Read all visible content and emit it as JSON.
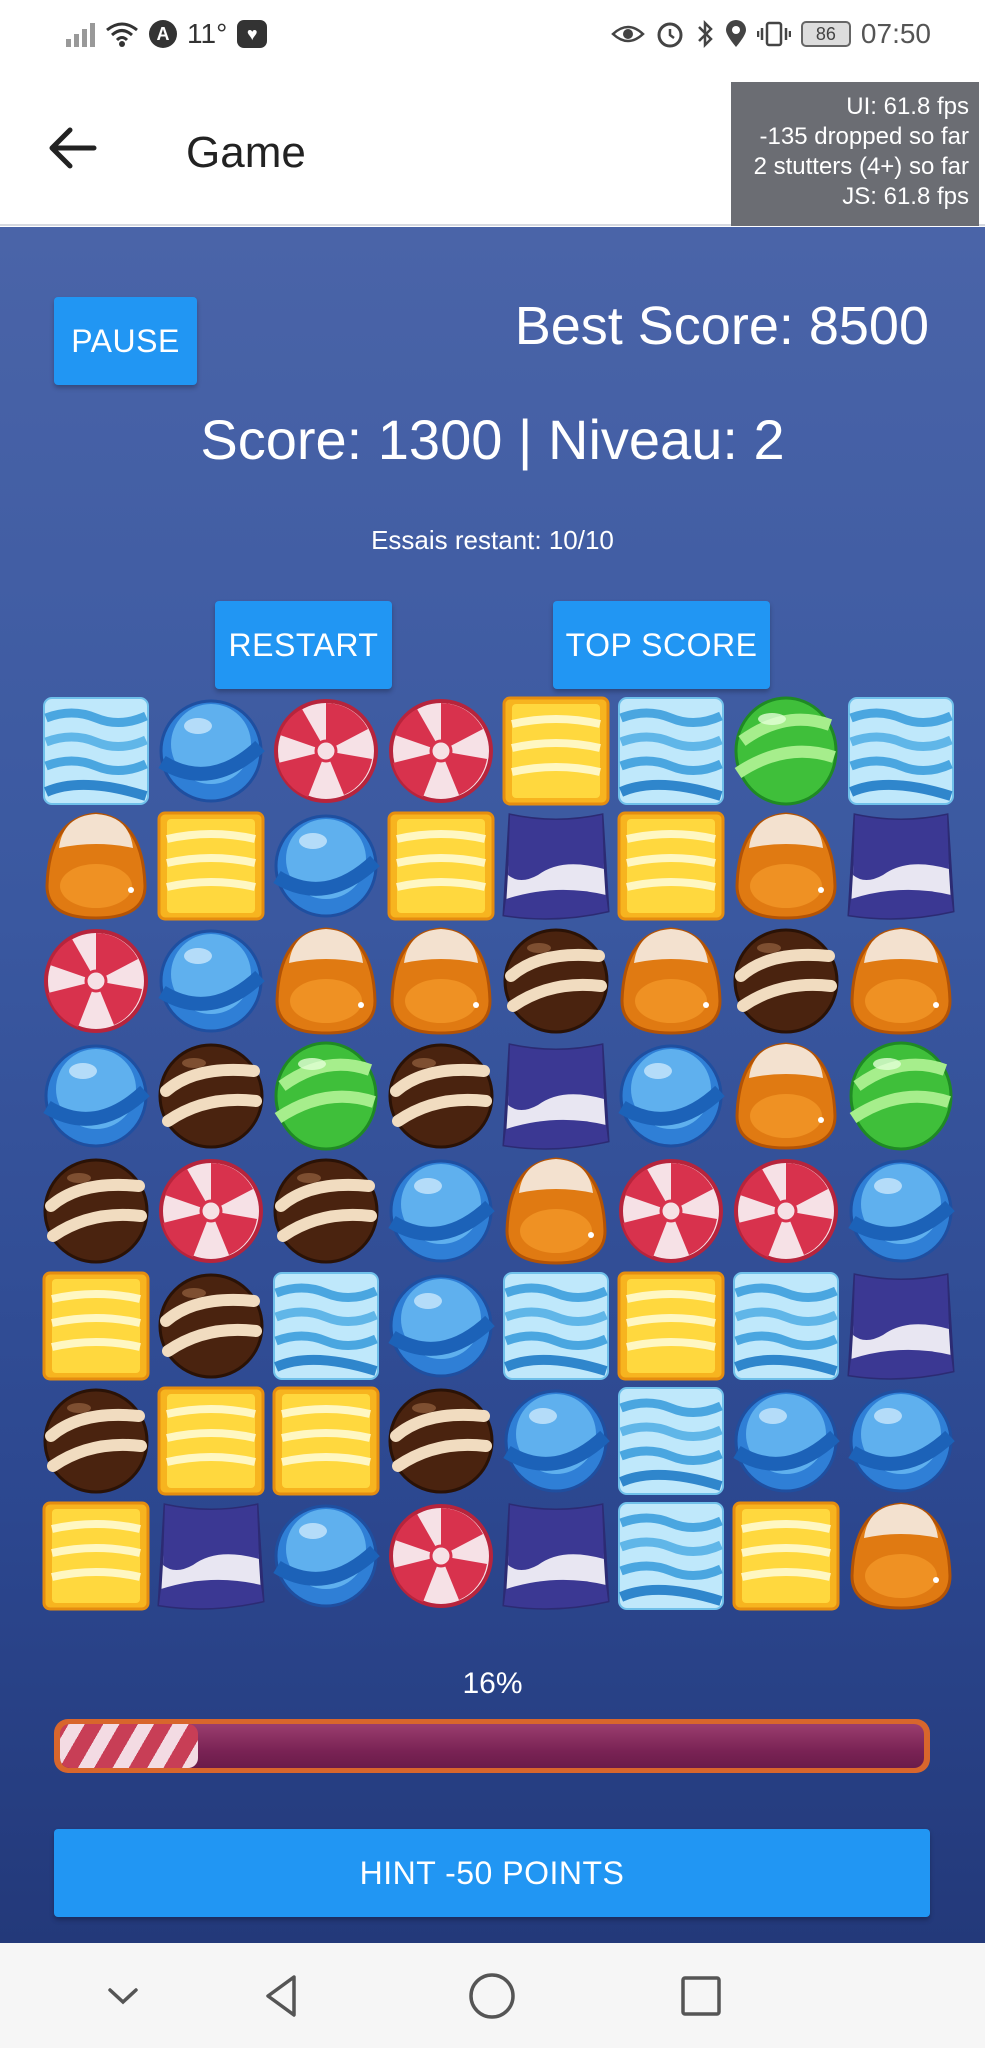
{
  "status_bar": {
    "temperature": "11°",
    "battery": "86",
    "time": "07:50"
  },
  "app_bar": {
    "title": "Game",
    "fps": {
      "ui": "UI: 61.8 fps",
      "dropped": "-135 dropped so far",
      "stutters": "2 stutters (4+) so far",
      "js": "JS: 61.8 fps"
    }
  },
  "game": {
    "pause_label": "PAUSE",
    "best_score": "Best Score: 8500",
    "score_line": "Score: 1300 | Niveau: 2",
    "tries": "Essais restant: 10/10",
    "restart_label": "RESTART",
    "top_score_label": "TOP SCORE",
    "progress_percent_text": "16%",
    "progress_fraction": 0.16,
    "hint_label": "HINT -50 POINTS"
  },
  "board": {
    "rows": 8,
    "cols": 8,
    "grid": [
      [
        "cyan-square",
        "blue-ball",
        "red-swirl",
        "red-swirl",
        "yellow-square",
        "cyan-square",
        "green-oval",
        "cyan-square"
      ],
      [
        "orange-drop",
        "yellow-square",
        "blue-ball",
        "yellow-square",
        "purple-wave",
        "yellow-square",
        "orange-drop",
        "purple-wave"
      ],
      [
        "red-swirl",
        "blue-ball",
        "orange-drop",
        "orange-drop",
        "brown-ball",
        "orange-drop",
        "brown-ball",
        "orange-drop"
      ],
      [
        "blue-ball",
        "brown-ball",
        "green-oval",
        "brown-ball",
        "purple-wave",
        "blue-ball",
        "orange-drop",
        "green-oval"
      ],
      [
        "brown-ball",
        "red-swirl",
        "brown-ball",
        "blue-ball",
        "orange-drop",
        "red-swirl",
        "red-swirl",
        "blue-ball"
      ],
      [
        "yellow-square",
        "brown-ball",
        "cyan-square",
        "blue-ball",
        "cyan-square",
        "yellow-square",
        "cyan-square",
        "purple-wave"
      ],
      [
        "brown-ball",
        "yellow-square",
        "yellow-square",
        "brown-ball",
        "blue-ball",
        "cyan-square",
        "blue-ball",
        "blue-ball"
      ],
      [
        "yellow-square",
        "purple-wave",
        "blue-ball",
        "red-swirl",
        "purple-wave",
        "cyan-square",
        "yellow-square",
        "orange-drop"
      ]
    ]
  },
  "colors": {
    "button": "#2196f3",
    "background_top": "#4a64a8",
    "background_bottom": "#23397a"
  },
  "icons": {
    "back": "arrow-left-icon",
    "nav_down": "chevron-down-icon",
    "nav_back": "triangle-back-icon",
    "nav_home": "circle-home-icon",
    "nav_recent": "square-recent-icon"
  }
}
